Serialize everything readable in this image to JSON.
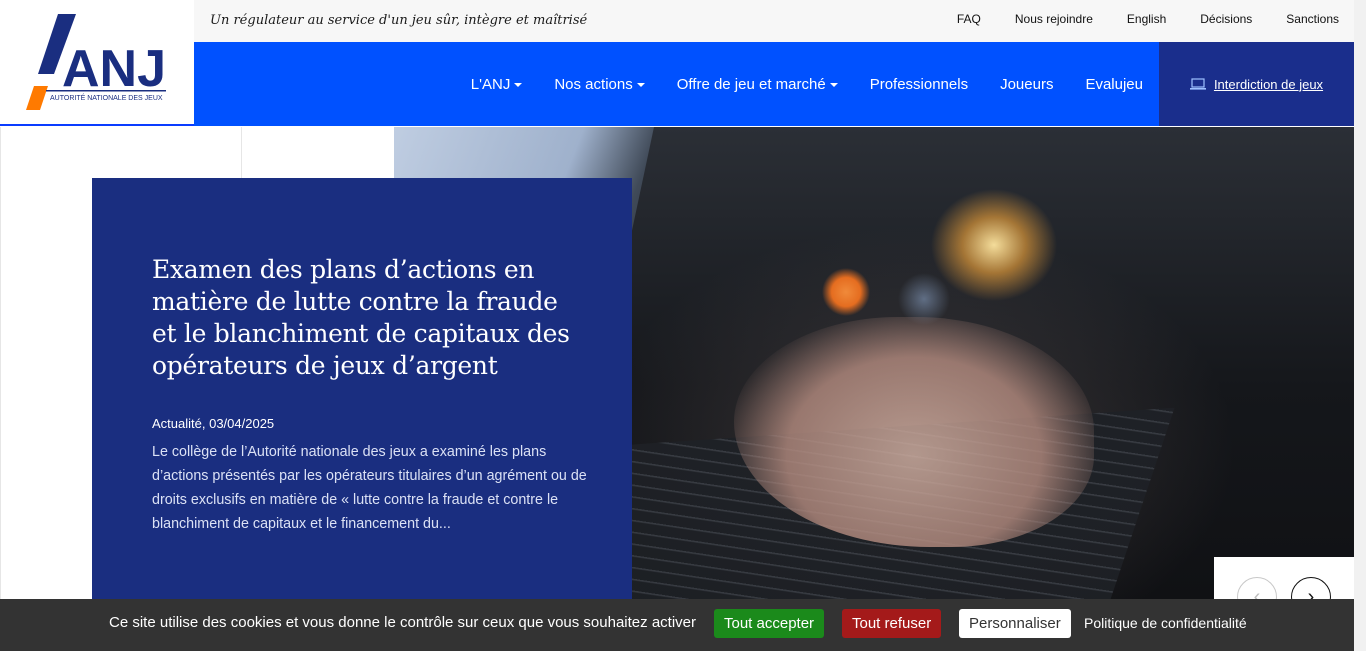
{
  "brand": {
    "logo_letters": "ANJ",
    "logo_subtitle": "AUTORITÉ NATIONALE DES JEUX",
    "color_primary": "#0051ff",
    "color_dark": "#1a2e80",
    "color_accent": "#ff7a00"
  },
  "topbar": {
    "tagline": "Un régulateur au service d'un jeu sûr, intègre et maîtrisé",
    "links": [
      "FAQ",
      "Nous rejoindre",
      "English",
      "Décisions",
      "Sanctions"
    ]
  },
  "nav": {
    "items": [
      {
        "label": "L'ANJ",
        "dropdown": true
      },
      {
        "label": "Nos actions",
        "dropdown": true
      },
      {
        "label": "Offre de jeu et marché",
        "dropdown": true
      },
      {
        "label": "Professionnels",
        "dropdown": false
      },
      {
        "label": "Joueurs",
        "dropdown": false
      },
      {
        "label": "Evalujeu",
        "dropdown": false
      }
    ],
    "interdiction": {
      "label": "Interdiction de jeux",
      "icon": "laptop-icon"
    }
  },
  "hero": {
    "title": "Examen des plans d’actions en matière de lutte contre la fraude et le blanchiment de capitaux des opérateurs de jeux d’argent",
    "meta": "Actualité, 03/04/2025",
    "excerpt": "Le collège de l’Autorité nationale des jeux a examiné les plans d’actions présentés par les opérateurs titulaires d’un agrément ou de droits exclusifs en matière de « lutte contre la fraude et contre le blanchiment de capitaux et le financement du...",
    "prev_icon": "‹",
    "next_icon": "›"
  },
  "cookie": {
    "message": "Ce site utilise des cookies et vous donne le contrôle sur ceux que vous souhaitez activer",
    "accept": "Tout accepter",
    "refuse": "Tout refuser",
    "customize": "Personnaliser",
    "policy": "Politique de confidentialité"
  }
}
